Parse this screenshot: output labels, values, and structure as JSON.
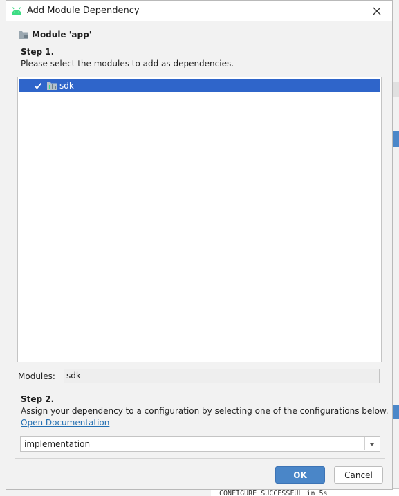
{
  "window": {
    "title": "Add Module Dependency",
    "app_icon": "android-icon",
    "close_icon": "close-icon"
  },
  "module_header": {
    "label": "Module 'app'",
    "icon": "folder-icon"
  },
  "step1": {
    "title": "Step 1.",
    "description": "Please select the modules to add as dependencies."
  },
  "module_list": {
    "items": [
      {
        "label": "sdk",
        "checked": true,
        "selected": true,
        "icon": "module-icon"
      }
    ]
  },
  "modules_field": {
    "label": "Modules:",
    "value": "sdk"
  },
  "step2": {
    "title": "Step 2.",
    "description": "Assign your dependency to a configuration by selecting one of the configurations below.",
    "link": "Open Documentation"
  },
  "configuration": {
    "value": "implementation"
  },
  "buttons": {
    "ok": "OK",
    "cancel": "Cancel"
  },
  "background": {
    "console_text": "CONFIGURE SUCCESSFUL in 5s"
  },
  "colors": {
    "selection": "#2f65ca",
    "primary_button": "#4a86c8",
    "link": "#2470b3",
    "android_green": "#3ddc84"
  }
}
